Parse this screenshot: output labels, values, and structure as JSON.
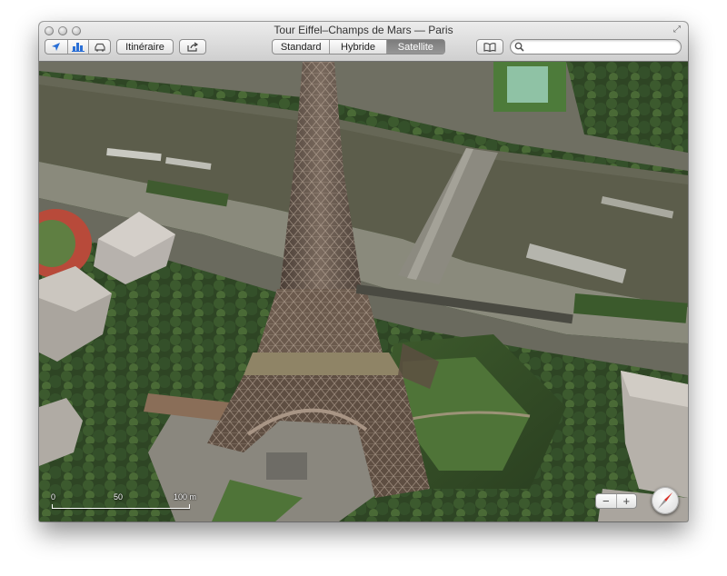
{
  "window": {
    "title": "Tour Eiffel–Champs de Mars — Paris"
  },
  "toolbar": {
    "location_icon": "location-arrow-icon",
    "view_3d_icon": "buildings-3d-icon",
    "traffic_icon": "car-icon",
    "directions_label": "Itinéraire",
    "share_icon": "share-icon",
    "map_types": [
      "Standard",
      "Hybride",
      "Satellite"
    ],
    "selected_map_type": "Satellite",
    "bookmarks_icon": "bookmarks-icon",
    "search_icon": "search-icon",
    "search_value": ""
  },
  "map": {
    "scale_labels": [
      "0",
      "50",
      "100 m"
    ],
    "zoom_out_label": "−",
    "zoom_in_label": "+",
    "compass_icon": "compass-icon"
  },
  "colors": {
    "selected_segment": "#888888",
    "compass_needle": "#d8332a"
  }
}
